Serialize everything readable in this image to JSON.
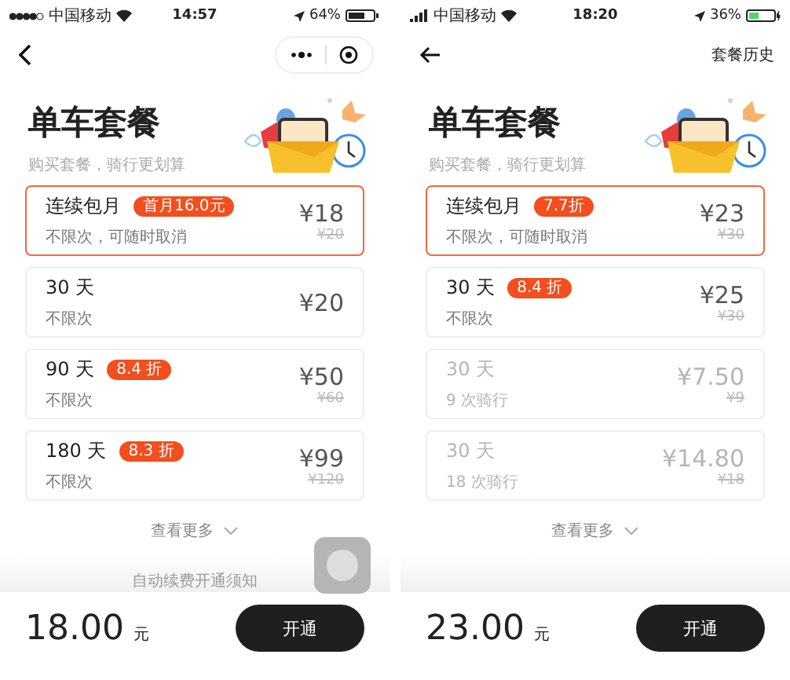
{
  "phones": [
    {
      "status_bar": {
        "carrier": "中国移动",
        "time": "14:57",
        "battery": "64%",
        "kind": "dots",
        "charging": false
      },
      "nav": {
        "kind": "capsule"
      },
      "title": "单车套餐",
      "subtitle": "购买套餐，骑行更划算",
      "plans": [
        {
          "title": "连续包月",
          "badge": "首月16.0元",
          "desc": "不限次，可随时取消",
          "price": "¥18",
          "original": "¥20",
          "selected": true,
          "disabled": false
        },
        {
          "title": "30 天",
          "desc": "不限次",
          "price": "¥20",
          "selected": false,
          "disabled": false
        },
        {
          "title": "90 天",
          "badge": "8.4 折",
          "desc": "不限次",
          "price": "¥50",
          "original": "¥60",
          "selected": false,
          "disabled": false
        },
        {
          "title": "180 天",
          "badge": "8.3 折",
          "desc": "不限次",
          "price": "¥99",
          "original": "¥120",
          "selected": false,
          "disabled": false
        }
      ],
      "more": "查看更多",
      "notice": "自动续费开通须知",
      "floating_button": true,
      "total": "18.00",
      "unit": "元",
      "submit": "开通"
    },
    {
      "status_bar": {
        "carrier": "中国移动",
        "time": "18:20",
        "battery": "36%",
        "kind": "bars",
        "charging": true
      },
      "nav": {
        "kind": "text",
        "action": "套餐历史"
      },
      "title": "单车套餐",
      "subtitle": "购买套餐，骑行更划算",
      "plans": [
        {
          "title": "连续包月",
          "badge": "7.7折",
          "desc": "不限次，可随时取消",
          "price": "¥23",
          "original": "¥30",
          "selected": true,
          "disabled": false
        },
        {
          "title": "30 天",
          "badge": "8.4 折",
          "desc": "不限次",
          "price": "¥25",
          "original": "¥30",
          "selected": false,
          "disabled": false
        },
        {
          "title": "30 天",
          "desc": "9 次骑行",
          "price": "¥7.50",
          "original": "¥9",
          "selected": false,
          "disabled": true
        },
        {
          "title": "30 天",
          "desc": "18 次骑行",
          "price": "¥14.80",
          "original": "¥18",
          "selected": false,
          "disabled": true
        }
      ],
      "more": "查看更多",
      "total": "23.00",
      "unit": "元",
      "submit": "开通"
    }
  ]
}
